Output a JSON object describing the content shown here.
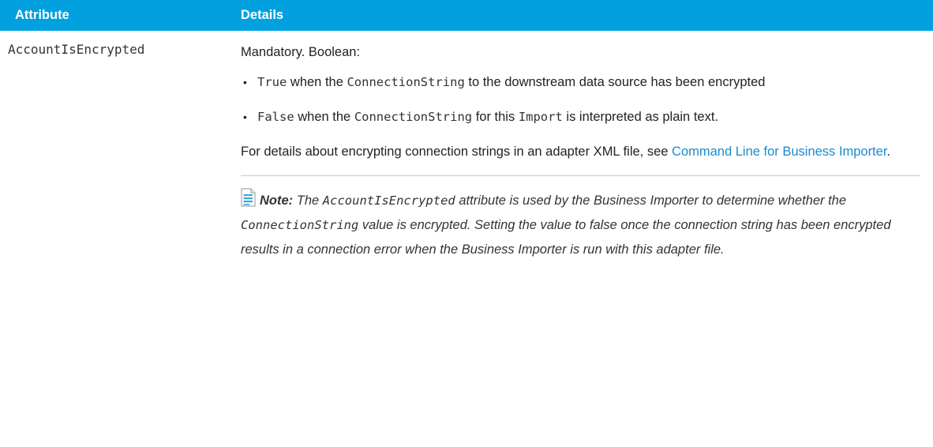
{
  "table": {
    "headers": {
      "attribute": "Attribute",
      "details": "Details"
    },
    "row": {
      "attribute": "AccountIsEncrypted",
      "intro": "Mandatory. Boolean:",
      "bullets": [
        {
          "code": "True",
          "text_1": " when the ",
          "code_2": "ConnectionString",
          "text_2": " to the downstream data source has been encrypted"
        },
        {
          "code": "False",
          "text_1": " when the ",
          "code_2": "ConnectionString",
          "text_2": " for this ",
          "code_3": "Import",
          "text_3": " is interpreted as plain text."
        }
      ],
      "details_text": "For details about encrypting connection strings in an adapter XML file, see ",
      "details_link": "Command Line for Business Importer",
      "details_end": ".",
      "note": {
        "label": "Note:",
        "text_1": " The ",
        "code_1": "AccountIsEncrypted",
        "text_2": " attribute is used by the Business Importer to determine whether the ",
        "code_2": "ConnectionString",
        "text_3": " value is encrypted. Setting the value to false once the connection string has been encrypted results in a connection error when the Business Importer is run with this adapter file.",
        "icon": "note-document-icon"
      }
    }
  },
  "colors": {
    "header_bg": "#00a1de",
    "header_text": "#ffffff",
    "link": "#1a8ad0"
  }
}
